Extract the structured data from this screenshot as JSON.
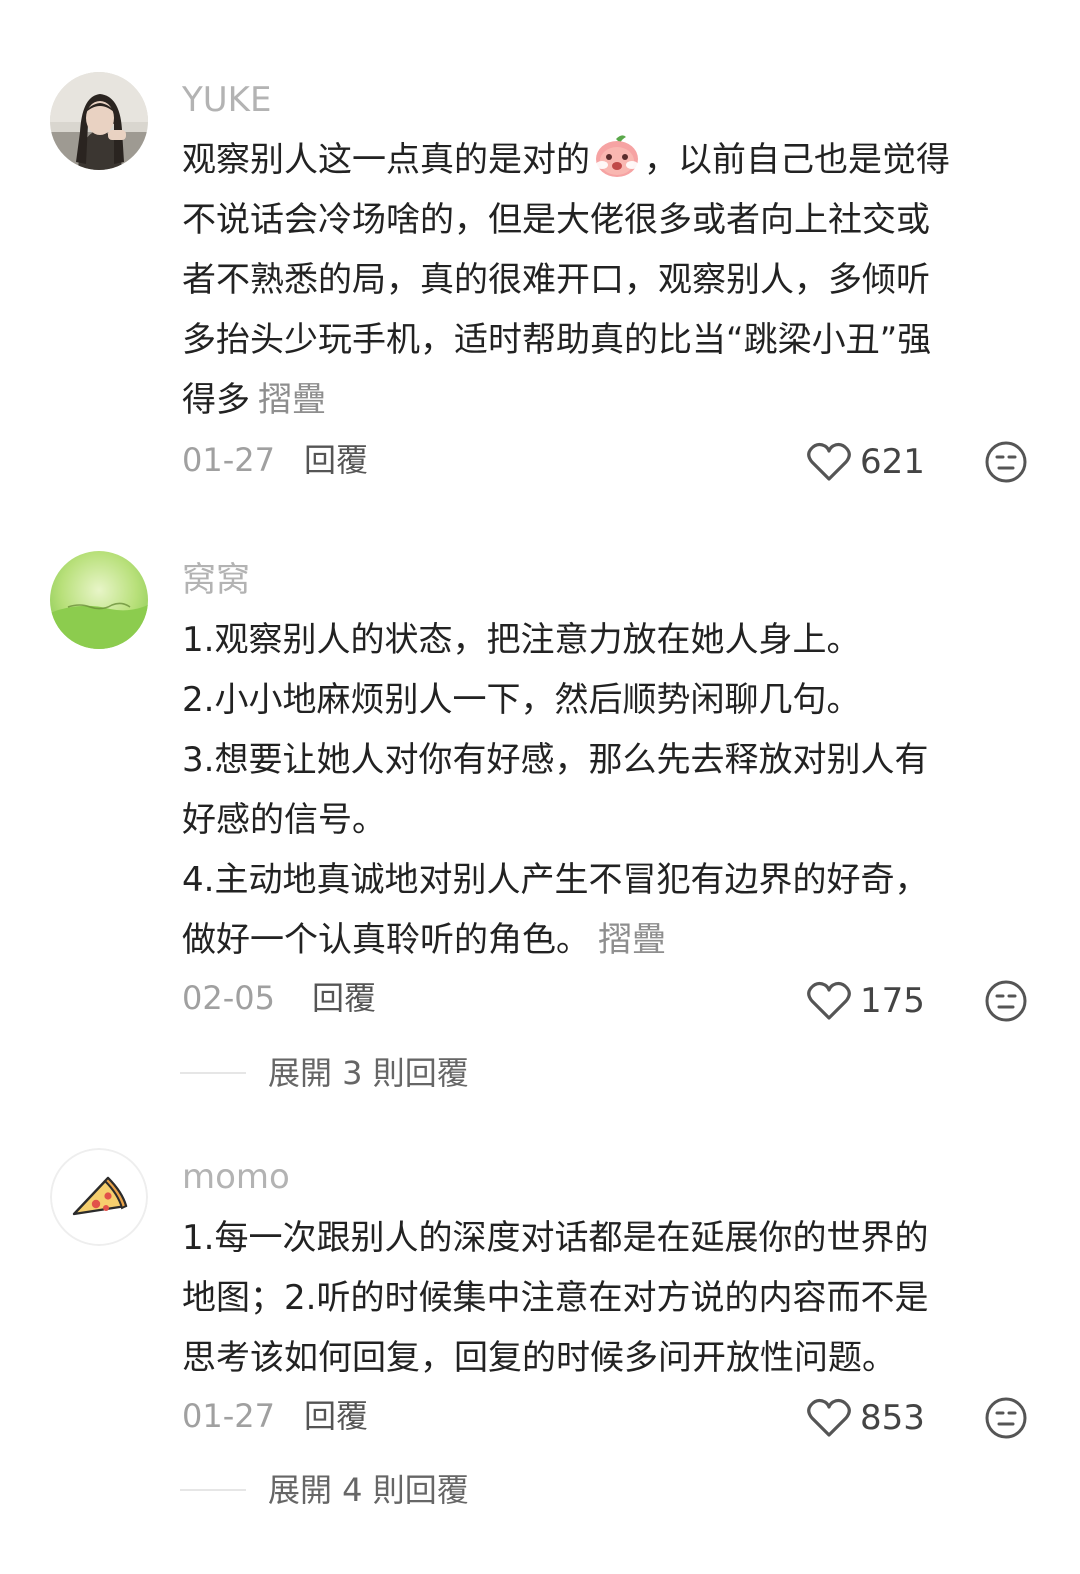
{
  "comments": [
    {
      "username": "YUKE",
      "lines": [
        "观察别人这一点真的是对的",
        "，以前自己也是觉得",
        "不说话会冷场啥的，但是大佬很多或者向上社交或",
        "者不熟悉的局，真的很难开口，观察别人，多倾听",
        "多抬头少玩手机，适时帮助真的比当“跳梁小丑”强",
        "得多"
      ],
      "collapse_label": "摺疊",
      "date": "01-27",
      "reply_label": "回覆",
      "likes": "621",
      "avatar_icon": "girl-portrait-avatar",
      "emoji_icon": "peach-face-emoji-icon"
    },
    {
      "username": "窝窝",
      "lines": [
        "1.观察别人的状态，把注意力放在她人身上。",
        "2.小小地麻烦别人一下，然后顺势闲聊几句。",
        "3.想要让她人对你有好感，那么先去释放对别人有",
        "好感的信号。",
        "4.主动地真诚地对别人产生不冒犯有边界的好奇，",
        "做好一个认真聆听的角色。"
      ],
      "collapse_label": "摺疊",
      "date": "02-05",
      "reply_label": "回覆",
      "likes": "175",
      "expand_label": "展開 3 則回覆",
      "avatar_icon": "green-field-avatar"
    },
    {
      "username": "momo",
      "lines": [
        "1.每一次跟别人的深度对话都是在延展你的世界的",
        "地图；2.听的时候集中注意在对方说的内容而不是",
        "思考该如何回复，回复的时候多问开放性问题。"
      ],
      "date": "01-27",
      "reply_label": "回覆",
      "likes": "853",
      "expand_label": "展開 4 則回覆",
      "avatar_icon": "pizza-slice-avatar"
    }
  ],
  "icons": {
    "like": "heart-outline-icon",
    "dislike": "meh-face-icon"
  },
  "colors": {
    "username": "#b3b3b3",
    "body_text": "#222222",
    "meta": "#a0a0a0",
    "icon_stroke": "#555555"
  }
}
